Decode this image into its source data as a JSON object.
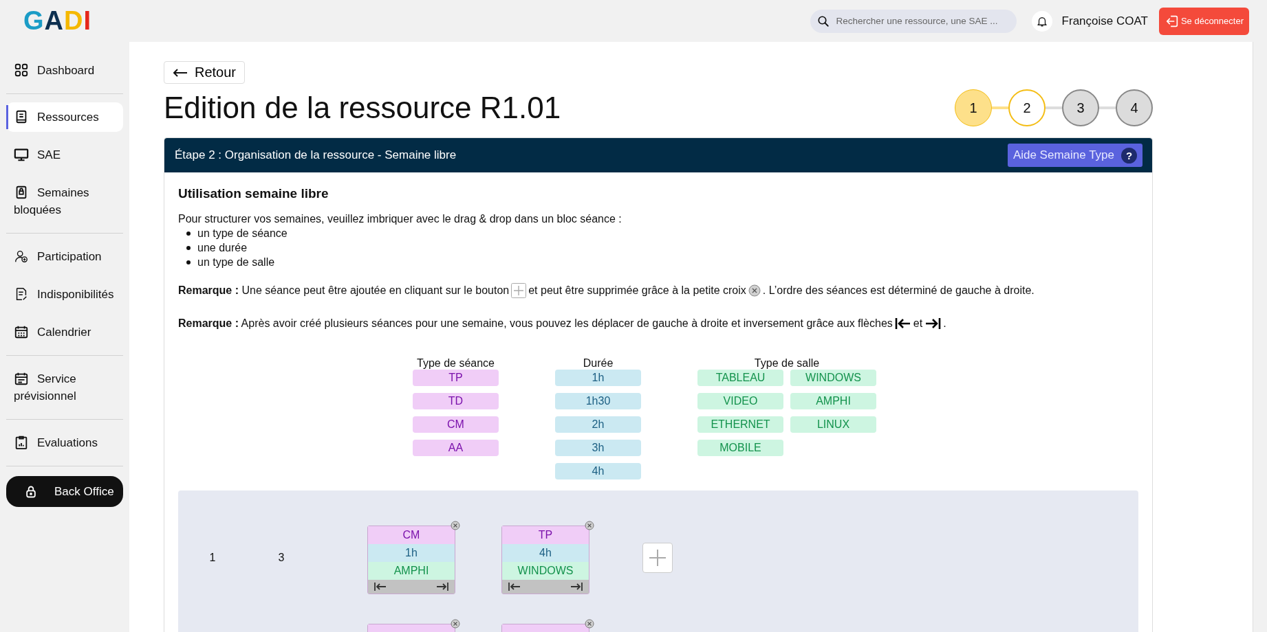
{
  "logo": [
    {
      "text": "G",
      "color": "#1b9cc6"
    },
    {
      "text": "A",
      "color": "#0d3050"
    },
    {
      "text": "D",
      "color": "#f5b800"
    },
    {
      "text": "I",
      "color": "#e5261b"
    }
  ],
  "search": {
    "placeholder": "Rechercher une ressource, une SAE ..."
  },
  "user": {
    "name": "Françoise COAT"
  },
  "logout": {
    "label": "Se déconnecter"
  },
  "sidebar": {
    "groups": [
      {
        "items": [
          {
            "label": "Dashboard",
            "selected": false
          }
        ]
      },
      {
        "items": [
          {
            "label": "Ressources",
            "selected": true
          },
          {
            "label": "SAE",
            "selected": false
          },
          {
            "label": "Semaines bloquées",
            "selected": false
          }
        ]
      },
      {
        "items": [
          {
            "label": "Participation",
            "selected": false
          },
          {
            "label": "Indisponibilités",
            "selected": false
          },
          {
            "label": "Calendrier",
            "selected": false
          }
        ]
      },
      {
        "items": [
          {
            "label": "Service prévisionnel",
            "selected": false
          }
        ]
      },
      {
        "items": [
          {
            "label": "Evaluations",
            "selected": false
          }
        ]
      }
    ],
    "back_office": {
      "label": "Back Office"
    }
  },
  "back": {
    "label": "Retour"
  },
  "title": "Edition de la ressource R1.01",
  "steps": [
    {
      "label": "1",
      "done": true,
      "selected": false
    },
    {
      "label": "2",
      "done": false,
      "selected": true
    },
    {
      "label": "3",
      "done": false,
      "selected": false
    },
    {
      "label": "4",
      "done": false,
      "selected": false
    }
  ],
  "card": {
    "header": "Étape 2 : Organisation de la ressource - Semaine libre",
    "help_button": {
      "label": "Aide Semaine Type",
      "icon": "?"
    },
    "heading": "Utilisation semaine libre",
    "intro": "Pour structurer vos semaines, veuillez imbriquer avec le drag & drop dans un bloc séance :",
    "bullets": [
      "un type de séance",
      "une durée",
      "un type de salle"
    ],
    "remarks": [
      {
        "parts": [
          {
            "kind": "text",
            "text": "**Remarque :** Une séance peut être ajoutée en cliquant sur le bouton"
          },
          {
            "kind": "plus"
          },
          {
            "kind": "text",
            "text": "et peut être supprimée grâce à la petite croix"
          },
          {
            "kind": "close"
          },
          {
            "kind": "text",
            "text": ". L’ordre des séances est déterminé de gauche à droite."
          }
        ]
      },
      {
        "parts": [
          {
            "kind": "text",
            "text": "**Remarque :** Après avoir créé plusieurs séances pour une semaine, vous pouvez les déplacer de gauche à droite et inversement grâce aux flèches"
          },
          {
            "kind": "left"
          },
          {
            "kind": "text",
            "text": "et"
          },
          {
            "kind": "right"
          },
          {
            "kind": "text",
            "text": "."
          }
        ]
      }
    ],
    "palette": [
      {
        "title": "Type de séance",
        "kind": "type",
        "tags": [
          "TP",
          "TD",
          "CM",
          "AA"
        ]
      },
      {
        "title": "Durée",
        "kind": "duration",
        "tags": [
          "1h",
          "1h30",
          "2h",
          "3h",
          "4h"
        ]
      },
      {
        "title": "Type de salle",
        "kind": "room",
        "tags": [
          "TABLEAU",
          "WINDOWS",
          "VIDEO",
          "AMPHI",
          "ETHERNET",
          "LINUX",
          "MOBILE"
        ]
      }
    ],
    "weeks": [
      {
        "week": "1",
        "count": "3",
        "sessions": [
          {
            "type": "CM",
            "duration": "1h",
            "room": "AMPHI"
          },
          {
            "type": "TP",
            "duration": "4h",
            "room": "WINDOWS"
          }
        ]
      },
      {
        "sessions": [
          {
            "kind": "hidden"
          },
          {
            "kind": "hidden"
          }
        ]
      }
    ]
  }
}
